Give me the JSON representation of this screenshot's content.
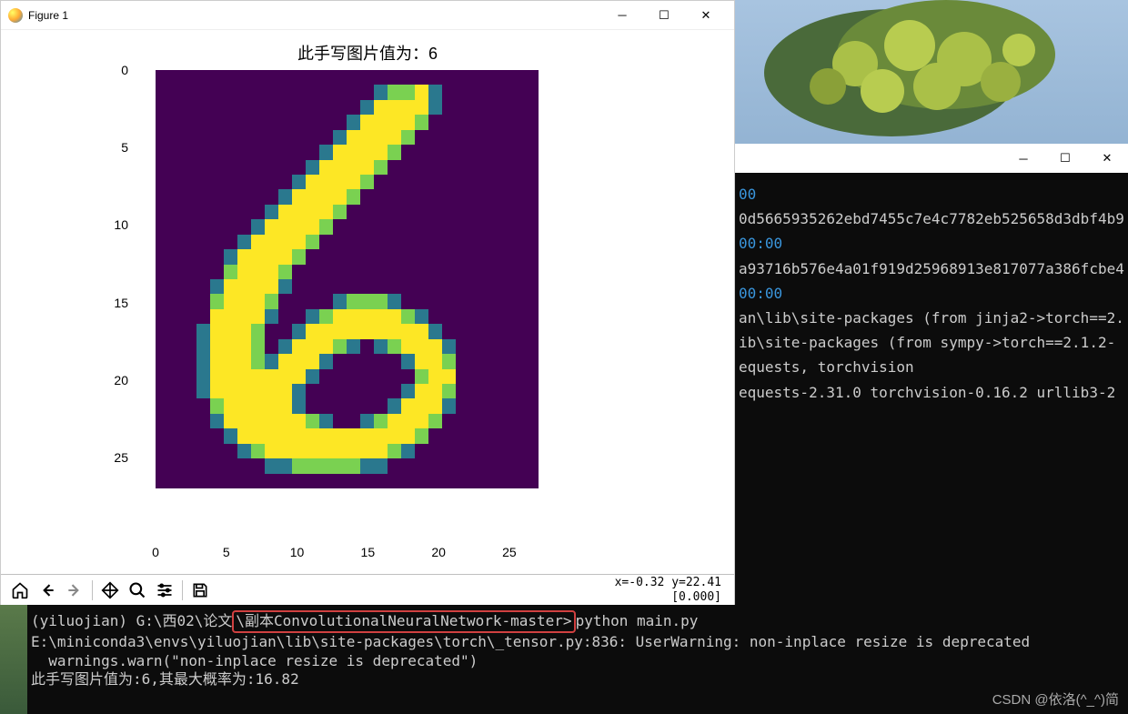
{
  "figure": {
    "window_title": "Figure 1",
    "plot_title": "此手写图片值为：6",
    "y_ticks": [
      0,
      5,
      10,
      15,
      20,
      25
    ],
    "x_ticks": [
      0,
      5,
      10,
      15,
      20,
      25
    ],
    "status_coords": "x=-0.32  y=22.41",
    "status_value": "[0.000]"
  },
  "chart_data": {
    "type": "heatmap",
    "title": "此手写图片值为：6",
    "xlabel": "",
    "ylabel": "",
    "xlim": [
      0,
      27
    ],
    "ylim": [
      27,
      0
    ],
    "colormap": "viridis",
    "description": "28x28 MNIST handwritten digit image showing the digit 6",
    "pixels_28x28_legend": "0=dark-purple bg, 1=teal edge, 2=green-yellow mid, 3=yellow bright",
    "pixels": [
      [
        0,
        0,
        0,
        0,
        0,
        0,
        0,
        0,
        0,
        0,
        0,
        0,
        0,
        0,
        0,
        0,
        0,
        0,
        0,
        0,
        0,
        0,
        0,
        0,
        0,
        0,
        0,
        0
      ],
      [
        0,
        0,
        0,
        0,
        0,
        0,
        0,
        0,
        0,
        0,
        0,
        0,
        0,
        0,
        0,
        0,
        1,
        2,
        2,
        3,
        1,
        0,
        0,
        0,
        0,
        0,
        0,
        0
      ],
      [
        0,
        0,
        0,
        0,
        0,
        0,
        0,
        0,
        0,
        0,
        0,
        0,
        0,
        0,
        0,
        1,
        3,
        3,
        3,
        3,
        1,
        0,
        0,
        0,
        0,
        0,
        0,
        0
      ],
      [
        0,
        0,
        0,
        0,
        0,
        0,
        0,
        0,
        0,
        0,
        0,
        0,
        0,
        0,
        1,
        3,
        3,
        3,
        3,
        2,
        0,
        0,
        0,
        0,
        0,
        0,
        0,
        0
      ],
      [
        0,
        0,
        0,
        0,
        0,
        0,
        0,
        0,
        0,
        0,
        0,
        0,
        0,
        1,
        3,
        3,
        3,
        3,
        2,
        0,
        0,
        0,
        0,
        0,
        0,
        0,
        0,
        0
      ],
      [
        0,
        0,
        0,
        0,
        0,
        0,
        0,
        0,
        0,
        0,
        0,
        0,
        1,
        3,
        3,
        3,
        3,
        2,
        0,
        0,
        0,
        0,
        0,
        0,
        0,
        0,
        0,
        0
      ],
      [
        0,
        0,
        0,
        0,
        0,
        0,
        0,
        0,
        0,
        0,
        0,
        1,
        3,
        3,
        3,
        3,
        2,
        0,
        0,
        0,
        0,
        0,
        0,
        0,
        0,
        0,
        0,
        0
      ],
      [
        0,
        0,
        0,
        0,
        0,
        0,
        0,
        0,
        0,
        0,
        1,
        3,
        3,
        3,
        3,
        2,
        0,
        0,
        0,
        0,
        0,
        0,
        0,
        0,
        0,
        0,
        0,
        0
      ],
      [
        0,
        0,
        0,
        0,
        0,
        0,
        0,
        0,
        0,
        1,
        3,
        3,
        3,
        3,
        2,
        0,
        0,
        0,
        0,
        0,
        0,
        0,
        0,
        0,
        0,
        0,
        0,
        0
      ],
      [
        0,
        0,
        0,
        0,
        0,
        0,
        0,
        0,
        1,
        3,
        3,
        3,
        3,
        2,
        0,
        0,
        0,
        0,
        0,
        0,
        0,
        0,
        0,
        0,
        0,
        0,
        0,
        0
      ],
      [
        0,
        0,
        0,
        0,
        0,
        0,
        0,
        1,
        3,
        3,
        3,
        3,
        2,
        0,
        0,
        0,
        0,
        0,
        0,
        0,
        0,
        0,
        0,
        0,
        0,
        0,
        0,
        0
      ],
      [
        0,
        0,
        0,
        0,
        0,
        0,
        1,
        3,
        3,
        3,
        3,
        2,
        0,
        0,
        0,
        0,
        0,
        0,
        0,
        0,
        0,
        0,
        0,
        0,
        0,
        0,
        0,
        0
      ],
      [
        0,
        0,
        0,
        0,
        0,
        1,
        3,
        3,
        3,
        3,
        2,
        0,
        0,
        0,
        0,
        0,
        0,
        0,
        0,
        0,
        0,
        0,
        0,
        0,
        0,
        0,
        0,
        0
      ],
      [
        0,
        0,
        0,
        0,
        0,
        2,
        3,
        3,
        3,
        2,
        0,
        0,
        0,
        0,
        0,
        0,
        0,
        0,
        0,
        0,
        0,
        0,
        0,
        0,
        0,
        0,
        0,
        0
      ],
      [
        0,
        0,
        0,
        0,
        1,
        3,
        3,
        3,
        3,
        1,
        0,
        0,
        0,
        0,
        0,
        0,
        0,
        0,
        0,
        0,
        0,
        0,
        0,
        0,
        0,
        0,
        0,
        0
      ],
      [
        0,
        0,
        0,
        0,
        2,
        3,
        3,
        3,
        2,
        0,
        0,
        0,
        0,
        1,
        2,
        2,
        2,
        1,
        0,
        0,
        0,
        0,
        0,
        0,
        0,
        0,
        0,
        0
      ],
      [
        0,
        0,
        0,
        0,
        3,
        3,
        3,
        3,
        1,
        0,
        0,
        1,
        2,
        3,
        3,
        3,
        3,
        3,
        2,
        1,
        0,
        0,
        0,
        0,
        0,
        0,
        0,
        0
      ],
      [
        0,
        0,
        0,
        1,
        3,
        3,
        3,
        2,
        0,
        0,
        1,
        3,
        3,
        3,
        3,
        3,
        3,
        3,
        3,
        3,
        1,
        0,
        0,
        0,
        0,
        0,
        0,
        0
      ],
      [
        0,
        0,
        0,
        1,
        3,
        3,
        3,
        2,
        0,
        1,
        3,
        3,
        3,
        2,
        1,
        0,
        1,
        2,
        3,
        3,
        3,
        1,
        0,
        0,
        0,
        0,
        0,
        0
      ],
      [
        0,
        0,
        0,
        1,
        3,
        3,
        3,
        2,
        1,
        3,
        3,
        3,
        1,
        0,
        0,
        0,
        0,
        0,
        1,
        3,
        3,
        2,
        0,
        0,
        0,
        0,
        0,
        0
      ],
      [
        0,
        0,
        0,
        1,
        3,
        3,
        3,
        3,
        3,
        3,
        3,
        1,
        0,
        0,
        0,
        0,
        0,
        0,
        0,
        2,
        3,
        3,
        0,
        0,
        0,
        0,
        0,
        0
      ],
      [
        0,
        0,
        0,
        1,
        3,
        3,
        3,
        3,
        3,
        3,
        1,
        0,
        0,
        0,
        0,
        0,
        0,
        0,
        1,
        3,
        3,
        2,
        0,
        0,
        0,
        0,
        0,
        0
      ],
      [
        0,
        0,
        0,
        0,
        2,
        3,
        3,
        3,
        3,
        3,
        1,
        0,
        0,
        0,
        0,
        0,
        0,
        1,
        3,
        3,
        3,
        1,
        0,
        0,
        0,
        0,
        0,
        0
      ],
      [
        0,
        0,
        0,
        0,
        1,
        3,
        3,
        3,
        3,
        3,
        3,
        2,
        1,
        0,
        0,
        1,
        2,
        3,
        3,
        3,
        2,
        0,
        0,
        0,
        0,
        0,
        0,
        0
      ],
      [
        0,
        0,
        0,
        0,
        0,
        1,
        3,
        3,
        3,
        3,
        3,
        3,
        3,
        3,
        3,
        3,
        3,
        3,
        3,
        2,
        0,
        0,
        0,
        0,
        0,
        0,
        0,
        0
      ],
      [
        0,
        0,
        0,
        0,
        0,
        0,
        1,
        2,
        3,
        3,
        3,
        3,
        3,
        3,
        3,
        3,
        3,
        2,
        1,
        0,
        0,
        0,
        0,
        0,
        0,
        0,
        0,
        0
      ],
      [
        0,
        0,
        0,
        0,
        0,
        0,
        0,
        0,
        1,
        1,
        2,
        2,
        2,
        2,
        2,
        1,
        1,
        0,
        0,
        0,
        0,
        0,
        0,
        0,
        0,
        0,
        0,
        0
      ],
      [
        0,
        0,
        0,
        0,
        0,
        0,
        0,
        0,
        0,
        0,
        0,
        0,
        0,
        0,
        0,
        0,
        0,
        0,
        0,
        0,
        0,
        0,
        0,
        0,
        0,
        0,
        0,
        0
      ]
    ]
  },
  "terminal_bg_lines": [
    {
      "cls": "term-cyan",
      "text": "00"
    },
    {
      "cls": "term-white",
      "text": "0d5665935262ebd7455c7e4c7782eb525658d3dbf4b9"
    },
    {
      "cls": "term-cyan",
      "text": "00:00"
    },
    {
      "cls": "term-white",
      "text": "a93716b576e4a01f919d25968913e817077a386fcbe4"
    },
    {
      "cls": "term-cyan",
      "text": "00:00"
    },
    {
      "cls": "term-white",
      "text": "an\\lib\\site-packages (from jinja2->torch==2."
    },
    {
      "cls": "term-white",
      "text": "ib\\site-packages (from sympy->torch==2.1.2-"
    },
    {
      "cls": "term-white",
      "text": "equests, torchvision"
    },
    {
      "cls": "term-white",
      "text": "equests-2.31.0 torchvision-0.16.2 urllib3-2"
    }
  ],
  "bottom_terminal": {
    "prompt_env": "(yiluojian) ",
    "prompt_path_before": "G:\\西02\\论文",
    "prompt_path_highlight": "\\副本ConvolutionalNeuralNetwork-master>",
    "prompt_cmd": "python main.py",
    "warn_line": "E:\\miniconda3\\envs\\yiluojian\\lib\\site-packages\\torch\\_tensor.py:836: UserWarning: non-inplace resize is deprecated",
    "warn_sub": "  warnings.warn(\"non-inplace resize is deprecated\")",
    "result_line": "此手写图片值为:6,其最大概率为:16.82"
  },
  "watermark": "CSDN @依洛(^_^)简"
}
